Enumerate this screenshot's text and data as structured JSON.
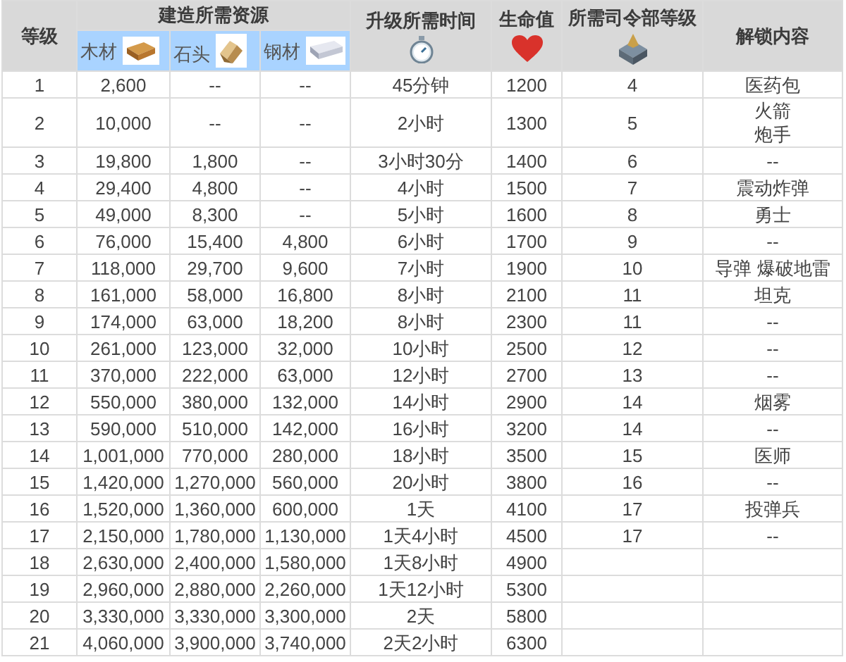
{
  "header": {
    "level": "等级",
    "resources_group": "建造所需资源",
    "resources": [
      {
        "label": "木材",
        "kind": "wood"
      },
      {
        "label": "石头",
        "kind": "stone"
      },
      {
        "label": "钢材",
        "kind": "steel"
      }
    ],
    "time": "升级所需时间",
    "hp": "生命值",
    "hq": "所需司令部等级",
    "unlock": "解锁内容"
  },
  "rows": [
    {
      "level": "1",
      "wood": "2,600",
      "stone": "--",
      "steel": "--",
      "time": "45分钟",
      "hp": "1200",
      "hq": "4",
      "unlock": [
        "医药包"
      ]
    },
    {
      "level": "2",
      "wood": "10,000",
      "stone": "--",
      "steel": "--",
      "time": "2小时",
      "hp": "1300",
      "hq": "5",
      "unlock": [
        "火箭",
        "炮手"
      ]
    },
    {
      "level": "3",
      "wood": "19,800",
      "stone": "1,800",
      "steel": "--",
      "time": "3小时30分",
      "hp": "1400",
      "hq": "6",
      "unlock": [
        "--"
      ]
    },
    {
      "level": "4",
      "wood": "29,400",
      "stone": "4,800",
      "steel": "--",
      "time": "4小时",
      "hp": "1500",
      "hq": "7",
      "unlock": [
        "震动炸弹"
      ]
    },
    {
      "level": "5",
      "wood": "49,000",
      "stone": "8,300",
      "steel": "--",
      "time": "5小时",
      "hp": "1600",
      "hq": "8",
      "unlock": [
        "勇士"
      ]
    },
    {
      "level": "6",
      "wood": "76,000",
      "stone": "15,400",
      "steel": "4,800",
      "time": "6小时",
      "hp": "1700",
      "hq": "9",
      "unlock": [
        "--"
      ]
    },
    {
      "level": "7",
      "wood": "118,000",
      "stone": "29,700",
      "steel": "9,600",
      "time": "7小时",
      "hp": "1900",
      "hq": "10",
      "unlock": [
        "导弹 爆破地雷"
      ]
    },
    {
      "level": "8",
      "wood": "161,000",
      "stone": "58,000",
      "steel": "16,800",
      "time": "8小时",
      "hp": "2100",
      "hq": "11",
      "unlock": [
        "坦克"
      ]
    },
    {
      "level": "9",
      "wood": "174,000",
      "stone": "63,000",
      "steel": "18,200",
      "time": "8小时",
      "hp": "2300",
      "hq": "11",
      "unlock": [
        "--"
      ]
    },
    {
      "level": "10",
      "wood": "261,000",
      "stone": "123,000",
      "steel": "32,000",
      "time": "10小时",
      "hp": "2500",
      "hq": "12",
      "unlock": [
        "--"
      ]
    },
    {
      "level": "11",
      "wood": "370,000",
      "stone": "222,000",
      "steel": "63,000",
      "time": "12小时",
      "hp": "2700",
      "hq": "13",
      "unlock": [
        "--"
      ]
    },
    {
      "level": "12",
      "wood": "550,000",
      "stone": "380,000",
      "steel": "132,000",
      "time": "14小时",
      "hp": "2900",
      "hq": "14",
      "unlock": [
        "烟雾"
      ]
    },
    {
      "level": "13",
      "wood": "590,000",
      "stone": "510,000",
      "steel": "142,000",
      "time": "16小时",
      "hp": "3200",
      "hq": "14",
      "unlock": [
        "--"
      ]
    },
    {
      "level": "14",
      "wood": "1,001,000",
      "stone": "770,000",
      "steel": "280,000",
      "time": "18小时",
      "hp": "3500",
      "hq": "15",
      "unlock": [
        "医师"
      ]
    },
    {
      "level": "15",
      "wood": "1,420,000",
      "stone": "1,270,000",
      "steel": "560,000",
      "time": "20小时",
      "hp": "3800",
      "hq": "16",
      "unlock": [
        "--"
      ]
    },
    {
      "level": "16",
      "wood": "1,520,000",
      "stone": "1,360,000",
      "steel": "600,000",
      "time": "1天",
      "hp": "4100",
      "hq": "17",
      "unlock": [
        "投弹兵"
      ]
    },
    {
      "level": "17",
      "wood": "2,150,000",
      "stone": "1,780,000",
      "steel": "1,130,000",
      "time": "1天4小时",
      "hp": "4500",
      "hq": "17",
      "unlock": [
        "--"
      ]
    },
    {
      "level": "18",
      "wood": "2,630,000",
      "stone": "2,400,000",
      "steel": "1,580,000",
      "time": "1天8小时",
      "hp": "4900"
    },
    {
      "level": "19",
      "wood": "2,960,000",
      "stone": "2,880,000",
      "steel": "2,260,000",
      "time": "1天12小时",
      "hp": "5300"
    },
    {
      "level": "20",
      "wood": "3,330,000",
      "stone": "3,330,000",
      "steel": "3,300,000",
      "time": "2天",
      "hp": "5800"
    },
    {
      "level": "21",
      "wood": "4,060,000",
      "stone": "3,900,000",
      "steel": "3,740,000",
      "time": "2天2小时",
      "hp": "6300"
    }
  ]
}
